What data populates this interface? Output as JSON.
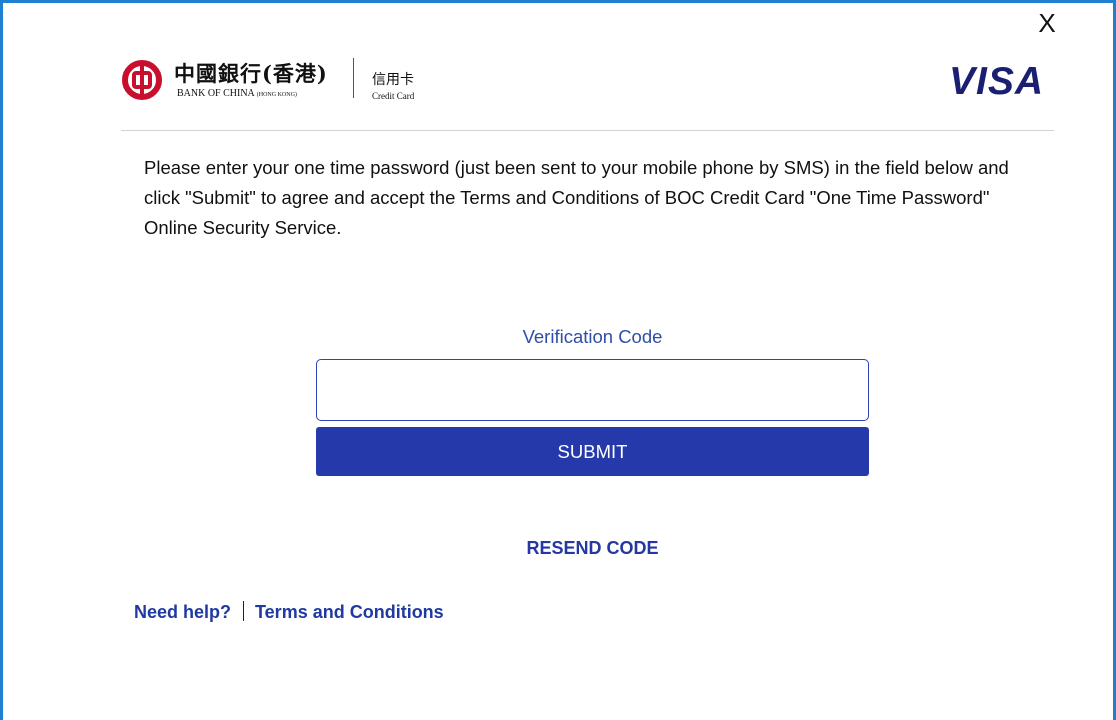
{
  "close_label": "X",
  "brand": {
    "bank_name_cn": "中國銀行(香港)",
    "bank_name_en": "BANK OF CHINA",
    "bank_name_en_sub": "(HONG KONG)",
    "card_cn": "信用卡",
    "card_en": "Credit Card",
    "network": "VISA",
    "colors": {
      "boc_red": "#c8102e",
      "visa_blue": "#1a1f71",
      "accent": "#2639aa"
    }
  },
  "instructions": "Please enter your one time password (just been sent to your mobile phone by SMS) in the field below and click \"Submit\" to agree and accept the Terms and Conditions of BOC Credit Card \"One Time Password\" Online Security Service.",
  "form": {
    "code_label": "Verification Code",
    "code_value_1": "",
    "code_value_2": "",
    "submit_label": "SUBMIT",
    "resend_label": "RESEND CODE"
  },
  "footer": {
    "help_label": "Need help?",
    "terms_label": "Terms and Conditions"
  },
  "icons": {
    "bank_logo": "boc-logo-icon",
    "close": "close-icon"
  }
}
